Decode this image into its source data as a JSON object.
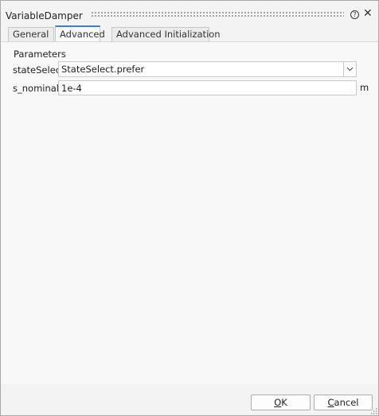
{
  "window": {
    "title": "VariableDamper",
    "help_icon": "question-mark-icon",
    "close_icon": "close-icon",
    "help_glyph": "?",
    "close_glyph": "✕"
  },
  "tabs": [
    {
      "label": "General",
      "active": false
    },
    {
      "label": "Advanced",
      "active": true
    },
    {
      "label": "Advanced Initialization",
      "active": false
    }
  ],
  "parameters": {
    "group_label": "Parameters",
    "stateSelect": {
      "label": "stateSelect",
      "value": "StateSelect.prefer"
    },
    "s_nominal": {
      "label": "s_nominal",
      "value": "1e-4",
      "unit": "m"
    }
  },
  "buttons": {
    "ok": {
      "mnemonic": "O",
      "rest": "K"
    },
    "cancel": {
      "mnemonic": "C",
      "rest": "ancel"
    }
  },
  "colors": {
    "accent": "#3a7dd8",
    "background": "#f0f0f0"
  }
}
